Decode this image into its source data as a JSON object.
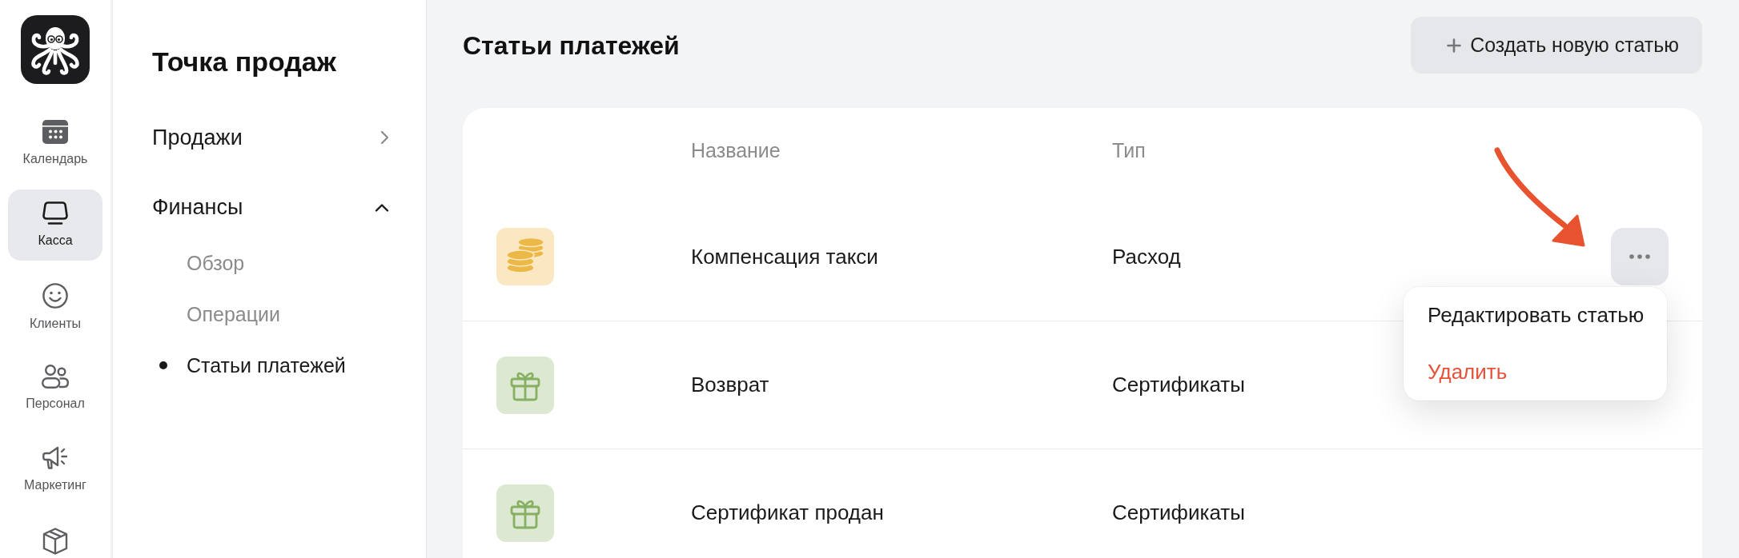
{
  "rail": {
    "nav": [
      {
        "label": "Календарь",
        "selected": false
      },
      {
        "label": "Касса",
        "selected": true
      },
      {
        "label": "Клиенты",
        "selected": false
      },
      {
        "label": "Персонал",
        "selected": false
      },
      {
        "label": "Маркетинг",
        "selected": false
      },
      {
        "selected": false
      }
    ]
  },
  "sidebar": {
    "title": "Точка продаж",
    "sections": [
      {
        "label": "Продажи",
        "expanded": false
      },
      {
        "label": "Финансы",
        "expanded": true,
        "children": [
          {
            "label": "Обзор",
            "selected": false
          },
          {
            "label": "Операции",
            "selected": false
          },
          {
            "label": "Статьи платежей",
            "selected": true
          }
        ]
      }
    ]
  },
  "page": {
    "title": "Статьи платежей",
    "create_button": "Создать новую статью"
  },
  "table": {
    "columns": [
      "Название",
      "Тип"
    ],
    "rows": [
      {
        "kind": "coins",
        "name": "Компенсация такси",
        "type": "Расход",
        "menu_open": true
      },
      {
        "kind": "gift",
        "name": "Возврат",
        "type": "Сертификаты",
        "menu_open": false
      },
      {
        "kind": "gift",
        "name": "Сертификат продан",
        "type": "Сертификаты",
        "menu_open": false
      }
    ]
  },
  "row_menu": {
    "items": [
      {
        "label": "Редактировать статью",
        "kind": "default"
      },
      {
        "label": "Удалить",
        "kind": "danger"
      }
    ]
  }
}
